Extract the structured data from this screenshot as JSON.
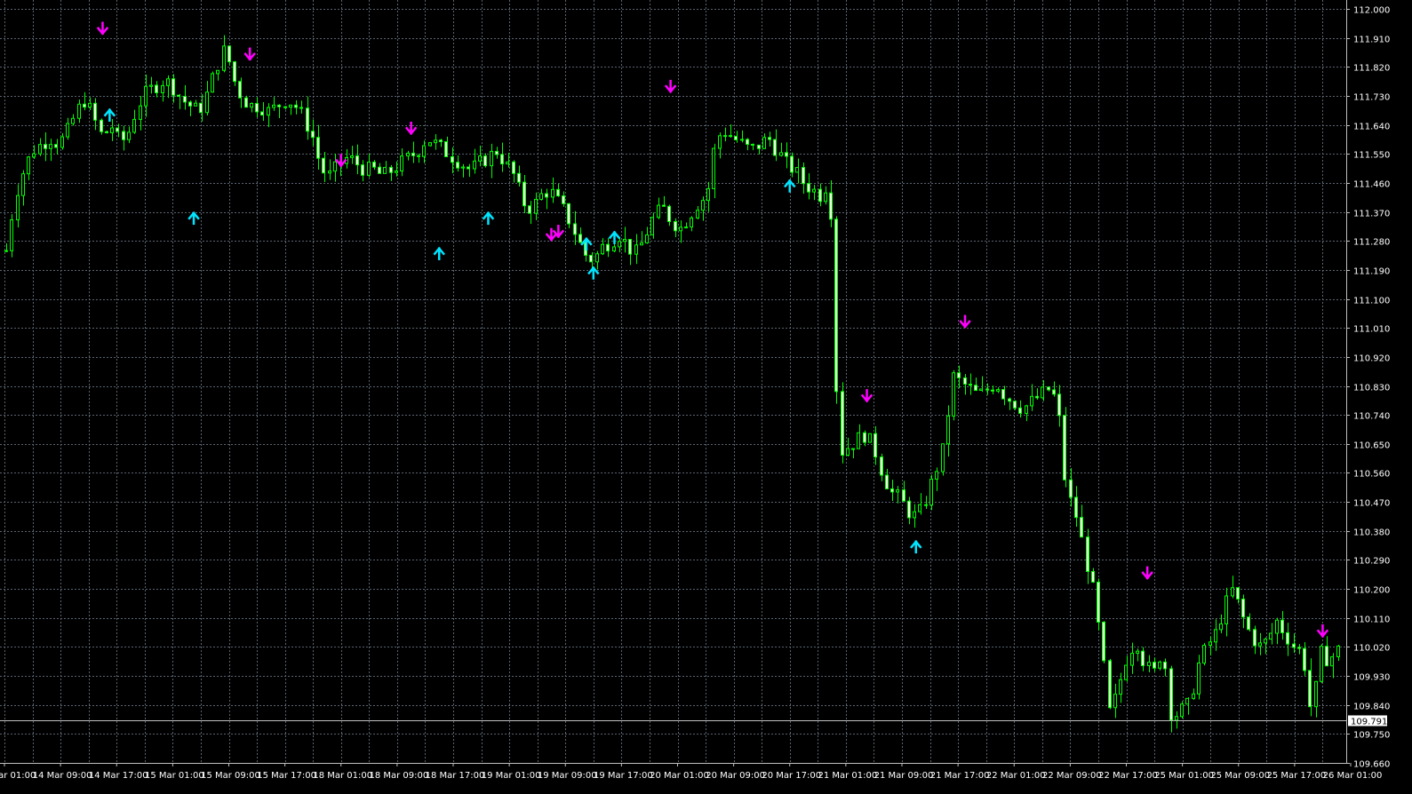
{
  "colors": {
    "background": "#000000",
    "grid": "#5a6470",
    "axis": "#c0c0c0",
    "candle": "#00ff00",
    "candle_body_bull": "#000000",
    "candle_body_bear": "#f0ffe0",
    "arrow_up": "#00e5ff",
    "arrow_down": "#ff00ff",
    "current_line": "#c0c0c0",
    "label": "#ffffff"
  },
  "chart_data": {
    "type": "candlestick",
    "symbol": "",
    "timeframe": "H1",
    "ylim": [
      109.66,
      112.0
    ],
    "y_ticks": [
      "112.000",
      "111.910",
      "111.820",
      "111.730",
      "111.640",
      "111.550",
      "111.460",
      "111.370",
      "111.280",
      "111.190",
      "111.100",
      "111.010",
      "110.920",
      "110.830",
      "110.740",
      "110.650",
      "110.560",
      "110.470",
      "110.380",
      "110.290",
      "110.200",
      "110.110",
      "110.020",
      "109.930",
      "109.840",
      "109.750",
      "109.660"
    ],
    "x_ticks": [
      "14 Mar 01:00",
      "14 Mar 09:00",
      "14 Mar 17:00",
      "15 Mar 01:00",
      "15 Mar 09:00",
      "15 Mar 17:00",
      "18 Mar 01:00",
      "18 Mar 09:00",
      "18 Mar 17:00",
      "19 Mar 01:00",
      "19 Mar 09:00",
      "19 Mar 17:00",
      "20 Mar 01:00",
      "20 Mar 09:00",
      "20 Mar 17:00",
      "21 Mar 01:00",
      "21 Mar 09:00",
      "21 Mar 17:00",
      "22 Mar 01:00",
      "22 Mar 09:00",
      "22 Mar 17:00",
      "25 Mar 01:00",
      "25 Mar 09:00",
      "25 Mar 17:00",
      "26 Mar 01:00"
    ],
    "current_price": "109.791",
    "grid": true,
    "close_path": [
      111.25,
      111.42,
      111.5,
      111.56,
      111.58,
      111.6,
      111.58,
      111.62,
      111.68,
      111.72,
      111.66,
      111.6,
      111.64,
      111.58,
      111.62,
      111.7,
      111.74,
      111.76,
      111.78,
      111.76,
      111.72,
      111.7,
      111.68,
      111.74,
      111.82,
      111.88,
      111.78,
      111.72,
      111.7,
      111.7,
      111.68,
      111.7,
      111.72,
      111.7,
      111.66,
      111.6,
      111.5,
      111.48,
      111.52,
      111.54,
      111.52,
      111.5,
      111.5,
      111.48,
      111.5,
      111.52,
      111.54,
      111.56,
      111.6,
      111.58,
      111.56,
      111.54,
      111.52,
      111.5,
      111.52,
      111.54,
      111.56,
      111.52,
      111.48,
      111.4,
      111.38,
      111.42,
      111.44,
      111.4,
      111.36,
      111.3,
      111.24,
      111.22,
      111.26,
      111.28,
      111.3,
      111.26,
      111.24,
      111.3,
      111.36,
      111.38,
      111.34,
      111.32,
      111.36,
      111.4,
      111.42,
      111.6,
      111.62,
      111.6,
      111.58,
      111.56,
      111.58,
      111.6,
      111.56,
      111.52,
      111.5,
      111.46,
      111.44,
      111.42,
      111.48,
      110.62,
      110.64,
      110.66,
      110.68,
      110.64,
      110.56,
      110.5,
      110.48,
      110.44,
      110.42,
      110.48,
      110.56,
      110.64,
      110.86,
      110.84,
      110.82,
      110.8,
      110.82,
      110.84,
      110.8,
      110.78,
      110.76,
      110.78,
      110.8,
      110.82,
      110.78,
      110.5,
      110.44,
      110.32,
      110.2,
      110.02,
      109.8,
      109.9,
      110.0,
      110.04,
      109.96,
      109.94,
      110.02,
      109.8,
      109.82,
      109.84,
      109.96,
      110.02,
      110.06,
      110.14,
      110.2,
      110.12,
      110.06,
      110.02,
      110.04,
      110.1,
      110.06,
      110.02,
      110.0,
      109.8,
      110.0,
      109.98,
      110.01
    ],
    "arrows_up": [
      {
        "x": "14 Mar 16:00",
        "y": 111.67
      },
      {
        "x": "15 Mar 04:00",
        "y": 111.35
      },
      {
        "x": "18 Mar 15:00",
        "y": 111.24
      },
      {
        "x": "18 Mar 22:00",
        "y": 111.35
      },
      {
        "x": "19 Mar 12:00",
        "y": 111.27
      },
      {
        "x": "19 Mar 13:00",
        "y": 111.18
      },
      {
        "x": "19 Mar 16:00",
        "y": 111.29
      },
      {
        "x": "20 Mar 17:00",
        "y": 111.45
      },
      {
        "x": "21 Mar 11:00",
        "y": 110.33
      }
    ],
    "arrows_down": [
      {
        "x": "14 Mar 15:00",
        "y": 111.94
      },
      {
        "x": "15 Mar 12:00",
        "y": 111.86
      },
      {
        "x": "18 Mar 01:00",
        "y": 111.53
      },
      {
        "x": "18 Mar 11:00",
        "y": 111.63
      },
      {
        "x": "19 Mar 07:00",
        "y": 111.3
      },
      {
        "x": "19 Mar 08:00",
        "y": 111.31
      },
      {
        "x": "20 Mar 00:00",
        "y": 111.76
      },
      {
        "x": "21 Mar 04:00",
        "y": 110.8
      },
      {
        "x": "21 Mar 18:00",
        "y": 111.03
      },
      {
        "x": "22 Mar 20:00",
        "y": 110.25
      },
      {
        "x": "25 Mar 21:00",
        "y": 110.07
      }
    ]
  }
}
